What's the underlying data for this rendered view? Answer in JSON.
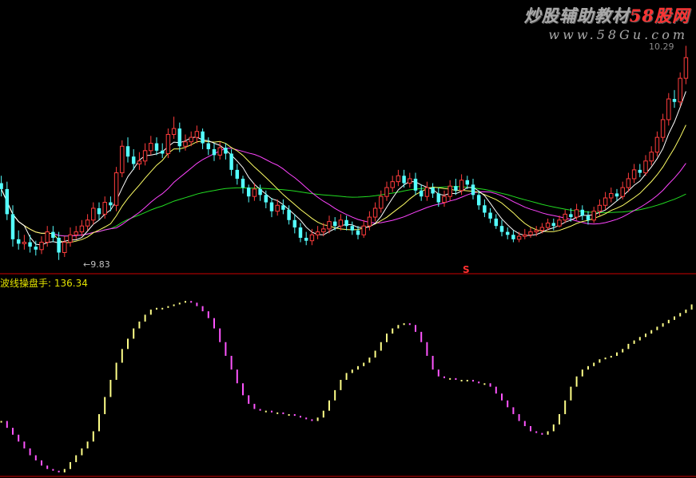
{
  "watermark": {
    "line1_prefix": "炒股辅助教材",
    "line1_brand": "58股网",
    "line2": "www.58Gu.com"
  },
  "price_panel": {
    "low_label": "9.83",
    "high_label": "10.29",
    "signal_mark": "S"
  },
  "indicator_panel": {
    "title": "波线操盘手",
    "value": ": 136.34"
  },
  "colors": {
    "background": "#000000",
    "up_candle": "#ff3c3c",
    "down_candle": "#54ffff",
    "ma_fast": "#ffffff",
    "ma_mid": "#ffff66",
    "ma_slow": "#ff44ff",
    "ma_long": "#22dd22",
    "indicator_up": "#ffff88",
    "indicator_down": "#ff55ff",
    "divider": "#cc0000"
  },
  "chart_data": [
    {
      "type": "candlestick",
      "x": [
        1,
        2,
        3,
        4,
        5,
        6,
        7,
        8,
        9,
        10,
        11,
        12,
        13,
        14,
        15,
        16,
        17,
        18,
        19,
        20,
        21,
        22,
        23,
        24,
        25,
        26,
        27,
        28,
        29,
        30,
        31,
        32,
        33,
        34,
        35,
        36,
        37,
        38,
        39,
        40,
        41,
        42,
        43,
        44,
        45,
        46,
        47,
        48,
        49,
        50,
        51,
        52,
        53,
        54,
        55,
        56,
        57,
        58,
        59,
        60,
        61,
        62,
        63,
        64,
        65,
        66,
        67,
        68,
        69,
        70,
        71,
        72,
        73,
        74,
        75,
        76,
        77,
        78,
        79,
        80,
        81,
        82,
        83,
        84,
        85,
        86,
        87,
        88,
        89,
        90,
        91,
        92,
        93,
        94,
        95,
        96,
        97,
        98,
        99,
        100,
        101,
        102,
        103,
        104,
        105,
        106,
        107,
        108,
        109,
        110,
        111,
        112,
        113,
        114,
        115,
        116,
        117,
        118,
        119,
        120,
        121,
        122,
        123,
        124
      ],
      "open": [
        10.35,
        10.31,
        10.14,
        9.97,
        9.94,
        9.95,
        9.92,
        9.9,
        9.95,
        10.02,
        9.98,
        9.88,
        9.95,
        10.0,
        10.02,
        10.06,
        10.1,
        10.18,
        10.14,
        10.22,
        10.2,
        10.42,
        10.6,
        10.53,
        10.48,
        10.5,
        10.57,
        10.62,
        10.57,
        10.55,
        10.68,
        10.72,
        10.6,
        10.63,
        10.66,
        10.7,
        10.62,
        10.58,
        10.54,
        10.59,
        10.55,
        10.44,
        10.38,
        10.32,
        10.26,
        10.31,
        10.27,
        10.22,
        10.16,
        10.2,
        10.17,
        10.1,
        10.05,
        9.98,
        9.96,
        10.0,
        10.02,
        10.04,
        10.09,
        10.06,
        10.1,
        10.06,
        10.03,
        10.0,
        10.06,
        10.12,
        10.18,
        10.26,
        10.32,
        10.36,
        10.4,
        10.35,
        10.38,
        10.3,
        10.26,
        10.32,
        10.28,
        10.22,
        10.26,
        10.33,
        10.3,
        10.37,
        10.34,
        10.27,
        10.2,
        10.15,
        10.11,
        10.06,
        10.02,
        10.0,
        9.97,
        9.99,
        10.0,
        10.02,
        10.03,
        10.05,
        10.08,
        10.06,
        10.1,
        10.14,
        10.12,
        10.17,
        10.13,
        10.1,
        10.16,
        10.2,
        10.25,
        10.28,
        10.26,
        10.32,
        10.38,
        10.44,
        10.42,
        10.5,
        10.56,
        10.66,
        10.78,
        10.92,
        10.9,
        11.06
      ],
      "close": [
        10.31,
        10.14,
        9.97,
        9.94,
        9.95,
        9.92,
        9.9,
        9.95,
        10.02,
        9.98,
        9.88,
        9.95,
        10.0,
        10.02,
        10.06,
        10.1,
        10.18,
        10.14,
        10.22,
        10.2,
        10.42,
        10.6,
        10.53,
        10.48,
        10.5,
        10.57,
        10.62,
        10.57,
        10.55,
        10.68,
        10.72,
        10.6,
        10.63,
        10.66,
        10.7,
        10.62,
        10.58,
        10.54,
        10.59,
        10.55,
        10.44,
        10.38,
        10.32,
        10.26,
        10.31,
        10.27,
        10.22,
        10.16,
        10.2,
        10.17,
        10.1,
        10.05,
        9.98,
        9.96,
        10.0,
        10.02,
        10.04,
        10.09,
        10.06,
        10.1,
        10.06,
        10.03,
        10.0,
        10.06,
        10.12,
        10.18,
        10.26,
        10.32,
        10.36,
        10.4,
        10.35,
        10.38,
        10.3,
        10.26,
        10.32,
        10.28,
        10.22,
        10.26,
        10.33,
        10.3,
        10.37,
        10.34,
        10.27,
        10.2,
        10.15,
        10.11,
        10.06,
        10.02,
        10.0,
        9.97,
        9.99,
        10.0,
        10.02,
        10.03,
        10.05,
        10.08,
        10.06,
        10.1,
        10.14,
        10.12,
        10.17,
        10.13,
        10.1,
        10.16,
        10.2,
        10.25,
        10.28,
        10.26,
        10.32,
        10.38,
        10.44,
        10.42,
        10.5,
        10.56,
        10.66,
        10.78,
        10.92,
        10.9,
        11.06,
        11.2
      ],
      "high": [
        10.4,
        10.36,
        10.2,
        10.03,
        10.0,
        10.0,
        9.96,
        9.99,
        10.06,
        10.06,
        10.02,
        9.99,
        10.05,
        10.06,
        10.1,
        10.14,
        10.22,
        10.22,
        10.26,
        10.26,
        10.46,
        10.64,
        10.66,
        10.58,
        10.56,
        10.62,
        10.67,
        10.66,
        10.62,
        10.72,
        10.8,
        10.76,
        10.68,
        10.7,
        10.74,
        10.72,
        10.66,
        10.62,
        10.63,
        10.62,
        10.58,
        10.48,
        10.4,
        10.34,
        10.35,
        10.34,
        10.3,
        10.25,
        10.24,
        10.24,
        10.2,
        10.14,
        10.08,
        10.02,
        10.04,
        10.06,
        10.08,
        10.13,
        10.12,
        10.14,
        10.13,
        10.09,
        10.06,
        10.1,
        10.16,
        10.22,
        10.3,
        10.36,
        10.4,
        10.44,
        10.44,
        10.42,
        10.42,
        10.34,
        10.36,
        10.35,
        10.32,
        10.3,
        10.37,
        10.38,
        10.41,
        10.4,
        10.38,
        10.3,
        10.24,
        10.18,
        10.14,
        10.1,
        10.05,
        10.03,
        10.02,
        10.04,
        10.05,
        10.06,
        10.08,
        10.11,
        10.11,
        10.13,
        10.17,
        10.18,
        10.21,
        10.2,
        10.16,
        10.19,
        10.24,
        10.29,
        10.32,
        10.31,
        10.36,
        10.42,
        10.48,
        10.48,
        10.54,
        10.6,
        10.7,
        10.82,
        10.96,
        10.98,
        11.1,
        11.28
      ],
      "low": [
        10.26,
        10.1,
        9.92,
        9.9,
        9.9,
        9.88,
        9.86,
        9.87,
        9.92,
        9.95,
        9.83,
        9.85,
        9.92,
        9.97,
        9.99,
        10.03,
        10.07,
        10.1,
        10.11,
        10.16,
        10.16,
        10.39,
        10.49,
        10.44,
        10.44,
        10.47,
        10.54,
        10.54,
        10.52,
        10.52,
        10.65,
        10.56,
        10.57,
        10.6,
        10.62,
        10.58,
        10.54,
        10.5,
        10.51,
        10.51,
        10.4,
        10.34,
        10.28,
        10.22,
        10.23,
        10.23,
        10.18,
        10.12,
        10.13,
        10.14,
        10.07,
        10.01,
        9.95,
        9.93,
        9.93,
        9.97,
        9.99,
        10.01,
        10.03,
        10.03,
        10.03,
        10.0,
        9.97,
        9.98,
        10.03,
        10.09,
        10.15,
        10.23,
        10.29,
        10.33,
        10.32,
        10.32,
        10.27,
        10.23,
        10.23,
        10.25,
        10.19,
        10.19,
        10.23,
        10.27,
        10.27,
        10.31,
        10.24,
        10.17,
        10.12,
        10.08,
        10.04,
        9.99,
        9.97,
        9.95,
        9.95,
        9.97,
        9.98,
        9.99,
        10.01,
        10.03,
        10.03,
        10.05,
        10.08,
        10.09,
        10.1,
        10.1,
        10.07,
        10.08,
        10.13,
        10.17,
        10.22,
        10.23,
        10.24,
        10.29,
        10.35,
        10.39,
        10.4,
        10.47,
        10.53,
        10.63,
        10.74,
        10.86,
        10.87,
        11.02
      ],
      "ylim": [
        9.78,
        11.32
      ],
      "annotations": [
        "9.83",
        "10.29",
        "S"
      ]
    },
    {
      "type": "bar",
      "title": "波线操盘手",
      "value_label": ": 136.34",
      "x": [
        1,
        2,
        3,
        4,
        5,
        6,
        7,
        8,
        9,
        10,
        11,
        12,
        13,
        14,
        15,
        16,
        17,
        18,
        19,
        20,
        21,
        22,
        23,
        24,
        25,
        26,
        27,
        28,
        29,
        30,
        31,
        32,
        33,
        34,
        35,
        36,
        37,
        38,
        39,
        40,
        41,
        42,
        43,
        44,
        45,
        46,
        47,
        48,
        49,
        50,
        51,
        52,
        53,
        54,
        55,
        56,
        57,
        58,
        59,
        60,
        61,
        62,
        63,
        64,
        65,
        66,
        67,
        68,
        69,
        70,
        71,
        72,
        73,
        74,
        75,
        76,
        77,
        78,
        79,
        80,
        81,
        82,
        83,
        84,
        85,
        86,
        87,
        88,
        89,
        90,
        91,
        92,
        93,
        94,
        95,
        96,
        97,
        98,
        99,
        100,
        101,
        102,
        103,
        104,
        105,
        106,
        107,
        108,
        109,
        110,
        111,
        112,
        113,
        114,
        115,
        116,
        117,
        118,
        119,
        120,
        121,
        122,
        123,
        124
      ],
      "values": [
        30,
        26,
        22,
        18,
        14,
        10,
        7,
        4,
        2,
        1,
        0,
        2,
        6,
        10,
        14,
        18,
        24,
        34,
        44,
        54,
        64,
        72,
        78,
        84,
        88,
        92,
        95,
        96,
        96,
        97,
        98,
        99,
        100,
        99,
        97,
        94,
        90,
        84,
        76,
        68,
        60,
        52,
        45,
        40,
        37,
        36,
        36,
        35,
        35,
        34,
        34,
        33,
        32,
        31,
        30,
        32,
        36,
        42,
        48,
        54,
        58,
        60,
        62,
        64,
        67,
        71,
        76,
        81,
        84,
        86,
        87,
        86,
        82,
        76,
        68,
        60,
        56,
        55,
        55,
        54,
        54,
        54,
        53,
        52,
        52,
        50,
        46,
        42,
        38,
        34,
        30,
        27,
        24,
        23,
        22,
        24,
        28,
        34,
        42,
        50,
        56,
        60,
        62,
        64,
        66,
        67,
        68,
        70,
        72,
        75,
        77,
        79,
        81,
        83,
        85,
        87,
        89,
        91,
        93,
        95,
        98,
        101,
        104,
        108
      ],
      "direction_colored": true
    }
  ]
}
